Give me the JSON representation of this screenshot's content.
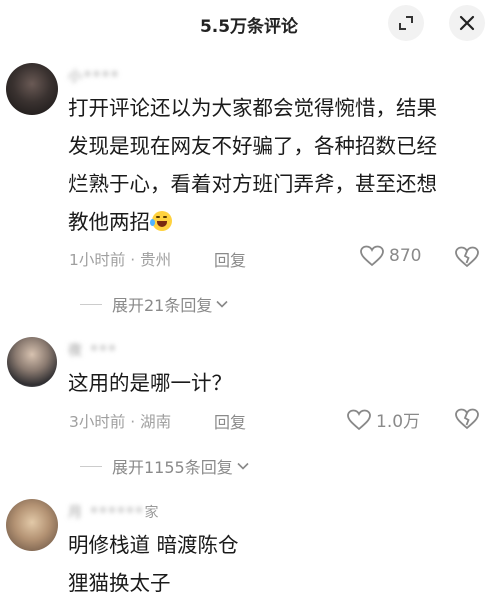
{
  "header": {
    "title": "5.5万条评论"
  },
  "comments": [
    {
      "name": "小****",
      "lines": [
        "打开评论还以为大家都会觉得惋惜，结果",
        "发现是现在网友不好骗了，各种招数已经",
        "烂熟于心，看着对方班门弄斧，甚至还想",
        "教他两招"
      ],
      "emoji": "laugh-cry-emoji",
      "time_location": "1小时前 · 贵州",
      "reply_label": "回复",
      "likes": "870",
      "expand_label": "展开21条回复"
    },
    {
      "name": "夜 ***",
      "lines": [
        "这用的是哪一计？"
      ],
      "time_location": "3小时前 · 湖南",
      "reply_label": "回复",
      "likes": "1.0万",
      "expand_label": "展开1155条回复"
    },
    {
      "name": "月 ******",
      "name_tail": "家",
      "lines": [
        "明修栈道 暗渡陈仓",
        "狸猫换太子"
      ]
    }
  ]
}
